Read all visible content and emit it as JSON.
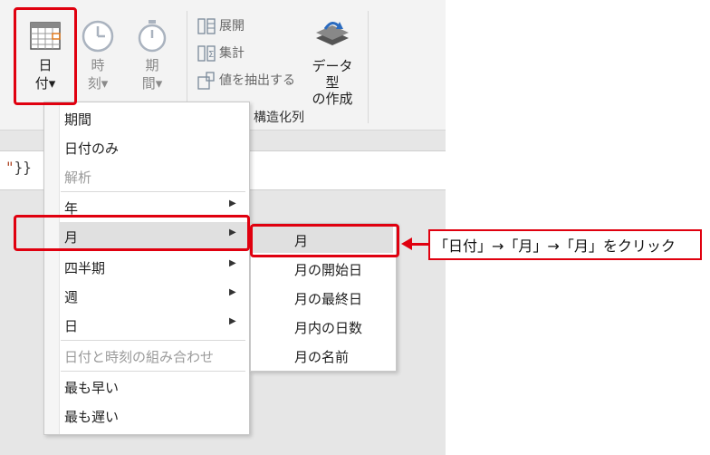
{
  "ribbon": {
    "date_btn_line1": "日",
    "date_btn_line2": "付▾",
    "time_btn_line1": "時",
    "time_btn_line2": "刻▾",
    "duration_btn_line1": "期",
    "duration_btn_line2": "間▾",
    "expand_label": "展開",
    "aggregate_label": "集計",
    "extract_values_label": "値を抽出する",
    "datatype_line1": "データ型",
    "datatype_line2": "の作成",
    "group_label": "構造化列"
  },
  "formula": {
    "text_quote": "\"",
    "text_rest": "}}"
  },
  "date_menu": {
    "items": [
      {
        "label": "期間"
      },
      {
        "label": "日付のみ"
      },
      {
        "label": "解析",
        "disabled": true
      },
      {
        "label": "年",
        "submenu": true
      },
      {
        "label": "月",
        "submenu": true,
        "highlighted": true
      },
      {
        "label": "四半期",
        "submenu": true
      },
      {
        "label": "週",
        "submenu": true
      },
      {
        "label": "日",
        "submenu": true
      },
      {
        "label": "日付と時刻の組み合わせ",
        "disabled": true
      },
      {
        "label": "最も早い"
      },
      {
        "label": "最も遅い"
      }
    ]
  },
  "month_submenu": {
    "items": [
      {
        "label": "月",
        "highlighted": true
      },
      {
        "label": "月の開始日"
      },
      {
        "label": "月の最終日"
      },
      {
        "label": "月内の日数"
      },
      {
        "label": "月の名前"
      }
    ]
  },
  "annotation": {
    "callout_text": "「日付」→「月」→「月」をクリック",
    "color": "#e0000f"
  }
}
